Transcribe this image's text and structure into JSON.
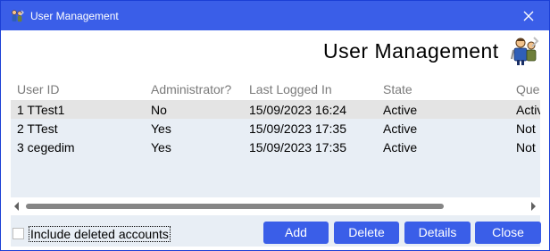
{
  "window": {
    "title": "User Management",
    "title_icon": "users-tools-icon",
    "close_icon": "close-icon"
  },
  "header": {
    "title": "User Management",
    "icon": "users-tools-icon"
  },
  "table": {
    "columns": [
      "User ID",
      "Administrator?",
      "Last Logged In",
      "State",
      "Que"
    ],
    "rows": [
      {
        "user_id": "1 TTest1",
        "admin": "No",
        "last_logged_in": "15/09/2023 16:24",
        "state": "Active",
        "extra": "Activ",
        "selected": true
      },
      {
        "user_id": "2 TTest",
        "admin": "Yes",
        "last_logged_in": "15/09/2023 17:35",
        "state": "Active",
        "extra": "Not",
        "selected": false
      },
      {
        "user_id": "3 cegedim",
        "admin": "Yes",
        "last_logged_in": "15/09/2023 17:35",
        "state": "Active",
        "extra": "Not",
        "selected": false
      }
    ]
  },
  "footer": {
    "include_deleted_label": "Include deleted accounts",
    "include_deleted_checked": false,
    "buttons": {
      "add": "Add",
      "delete": "Delete",
      "details": "Details",
      "close": "Close"
    }
  },
  "colors": {
    "titlebar": "#3a5ee8",
    "button": "#3a5ee8",
    "list_background": "#e8eef5",
    "selected_row": "#e4e4e4"
  }
}
